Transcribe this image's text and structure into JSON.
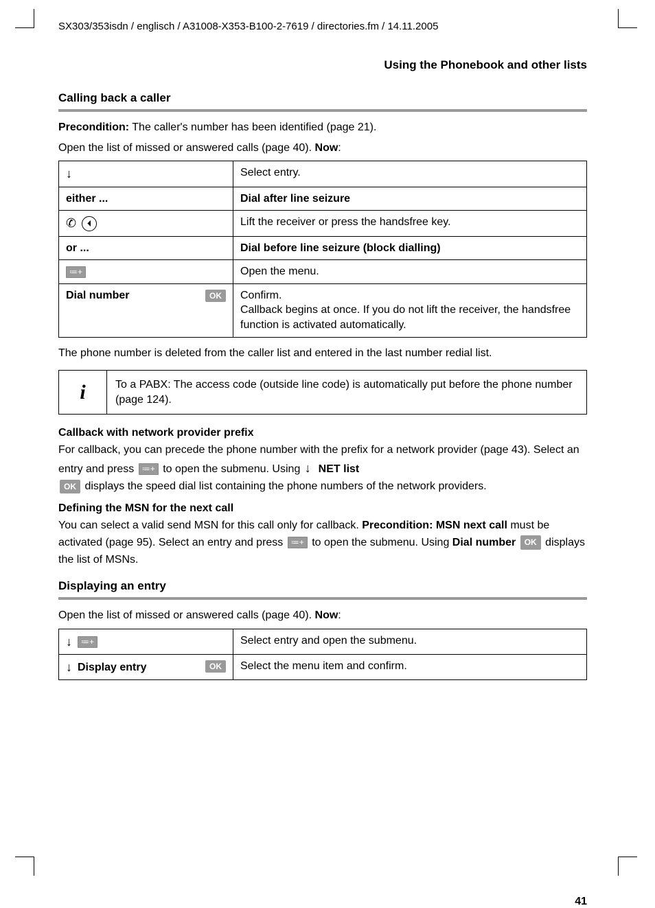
{
  "header_path": "SX303/353isdn / englisch / A31008-X353-B100-2-7619 / directories.fm / 14.11.2005",
  "section_title": "Using the Phonebook and other lists",
  "sub1": "Calling back a caller",
  "pre_label": "Precondition:",
  "pre_text": " The caller's number has been identified (page 21).",
  "open_list": "Open the list of missed or answered calls (page 40). ",
  "now": "Now",
  "table1": {
    "r1_right": "Select entry.",
    "r2_left": "either ...",
    "r2_right": "Dial after line seizure",
    "r3_right": "Lift the receiver or press the handsfree key.",
    "r4_left": "or ...",
    "r4_right": "Dial before line seizure (block dialling)",
    "r5_right": "Open the menu.",
    "r6_left": "Dial number",
    "r6_right": "Confirm.\nCallback begins at once. If you do not lift the receiver, the handsfree function is activated automatically."
  },
  "after_table": "The phone number is deleted from the caller list and entered in the last number redial list.",
  "info_i": "i",
  "info_text": "To a PABX: The access code (outside line code) is automatically put before the phone number (page 124).",
  "cb_prefix_h": "Callback with network provider prefix",
  "cb_prefix_1": "For callback, you can precede the phone number with the prefix for a network provider (page 43). Select an entry and press ",
  "cb_prefix_2": " to open the submenu. Using  ",
  "net_list": "NET list",
  "cb_prefix_3": " displays the speed dial list containing the phone numbers of the network providers.",
  "msn_h": "Defining the MSN for the next call",
  "msn_1": "You can select a valid send MSN for this call only for callback. ",
  "msn_pre": "Precondition: MSN next call",
  "msn_2": " must be activated (page 95). Select an entry and press ",
  "msn_3": " to open the submenu. Using ",
  "dial_number": "Dial number",
  "msn_4": " displays the list of MSNs.",
  "sub2": "Displaying an entry",
  "open_list2": "Open the list of missed or answered calls (page 40). ",
  "table2": {
    "r1_right": "Select entry and open the submenu.",
    "r2_left": "Display entry",
    "r2_right": "Select the menu item and confirm."
  },
  "ok": "OK",
  "menu_glyph": "≔+",
  "page_num": "41"
}
